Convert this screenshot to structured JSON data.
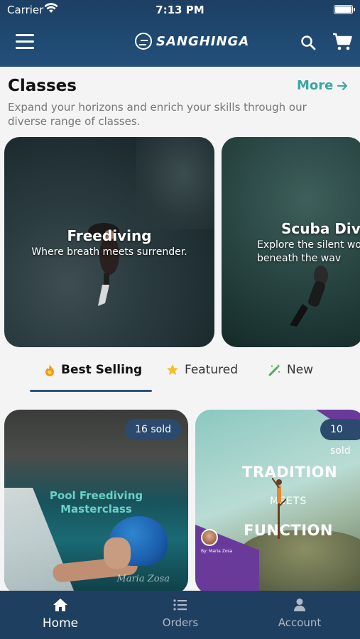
{
  "status_bar": {
    "carrier": "Carrier",
    "time": "7:13 PM"
  },
  "header": {
    "brand": "SANGHINGA"
  },
  "classes": {
    "title": "Classes",
    "more_label": "More",
    "subtitle": "Expand your horizons and enrich your skills through our diverse range of classes.",
    "cards": [
      {
        "title": "Freediving",
        "subtitle": "Where breath meets surrender."
      },
      {
        "title": "Scuba Divin",
        "subtitle": "Explore the silent wo beneath the wav"
      }
    ]
  },
  "tabs": [
    {
      "label": "Best Selling",
      "icon": "flame-icon",
      "active": true
    },
    {
      "label": "Featured",
      "icon": "star-icon",
      "active": false
    },
    {
      "label": "New",
      "icon": "magic-wand-icon",
      "active": false
    }
  ],
  "products": [
    {
      "badge": "16 sold",
      "title_line1": "Pool Freediving",
      "title_line2": "Masterclass",
      "signature": "Maria Zosa"
    },
    {
      "badge": "10 sold",
      "headline_1": "TRADITION",
      "headline_2": "MEETS",
      "headline_3": "FUNCTION",
      "byline": "By: Maria Zosa"
    }
  ],
  "bottom_nav": [
    {
      "label": "Home",
      "icon": "home-icon",
      "active": true
    },
    {
      "label": "Orders",
      "icon": "list-icon",
      "active": false
    },
    {
      "label": "Account",
      "icon": "user-icon",
      "active": false
    }
  ],
  "colors": {
    "header_bg": "#1f4a72",
    "accent_teal": "#3aa6a0",
    "badge_bg": "#2b4a6e",
    "bottom_nav_bg": "#1f3f61"
  }
}
